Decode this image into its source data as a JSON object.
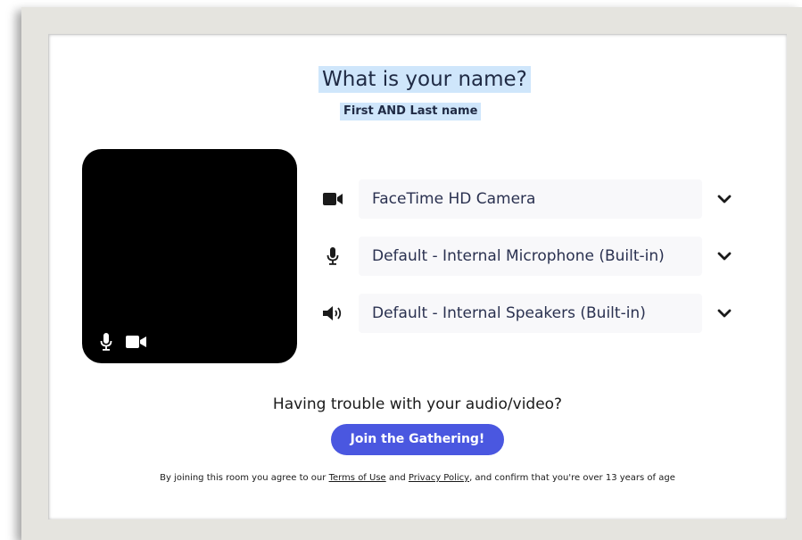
{
  "header": {
    "title": "What is your name?",
    "subtitle": "First AND Last name"
  },
  "preview": {
    "mic_icon": "microphone-icon",
    "camera_icon": "video-camera-icon"
  },
  "devices": {
    "camera": {
      "label": "FaceTime HD Camera",
      "icon": "video-camera-icon"
    },
    "microphone": {
      "label": "Default - Internal Microphone (Built-in)",
      "icon": "microphone-icon"
    },
    "speakers": {
      "label": "Default - Internal Speakers (Built-in)",
      "icon": "speaker-icon"
    }
  },
  "help": {
    "trouble_text": "Having trouble with your audio/video?"
  },
  "join_button": {
    "label": "Join the Gathering!",
    "color": "#4a57e0"
  },
  "legal": {
    "prefix": "By joining this room you agree to our",
    "terms_link": "Terms of Use",
    "and": "and",
    "privacy_link": "Privacy Policy",
    "suffix": ", and confirm that you're over 13 years of age"
  },
  "colors": {
    "highlight": "#cfe6fb",
    "frame": "#e5e4df"
  }
}
